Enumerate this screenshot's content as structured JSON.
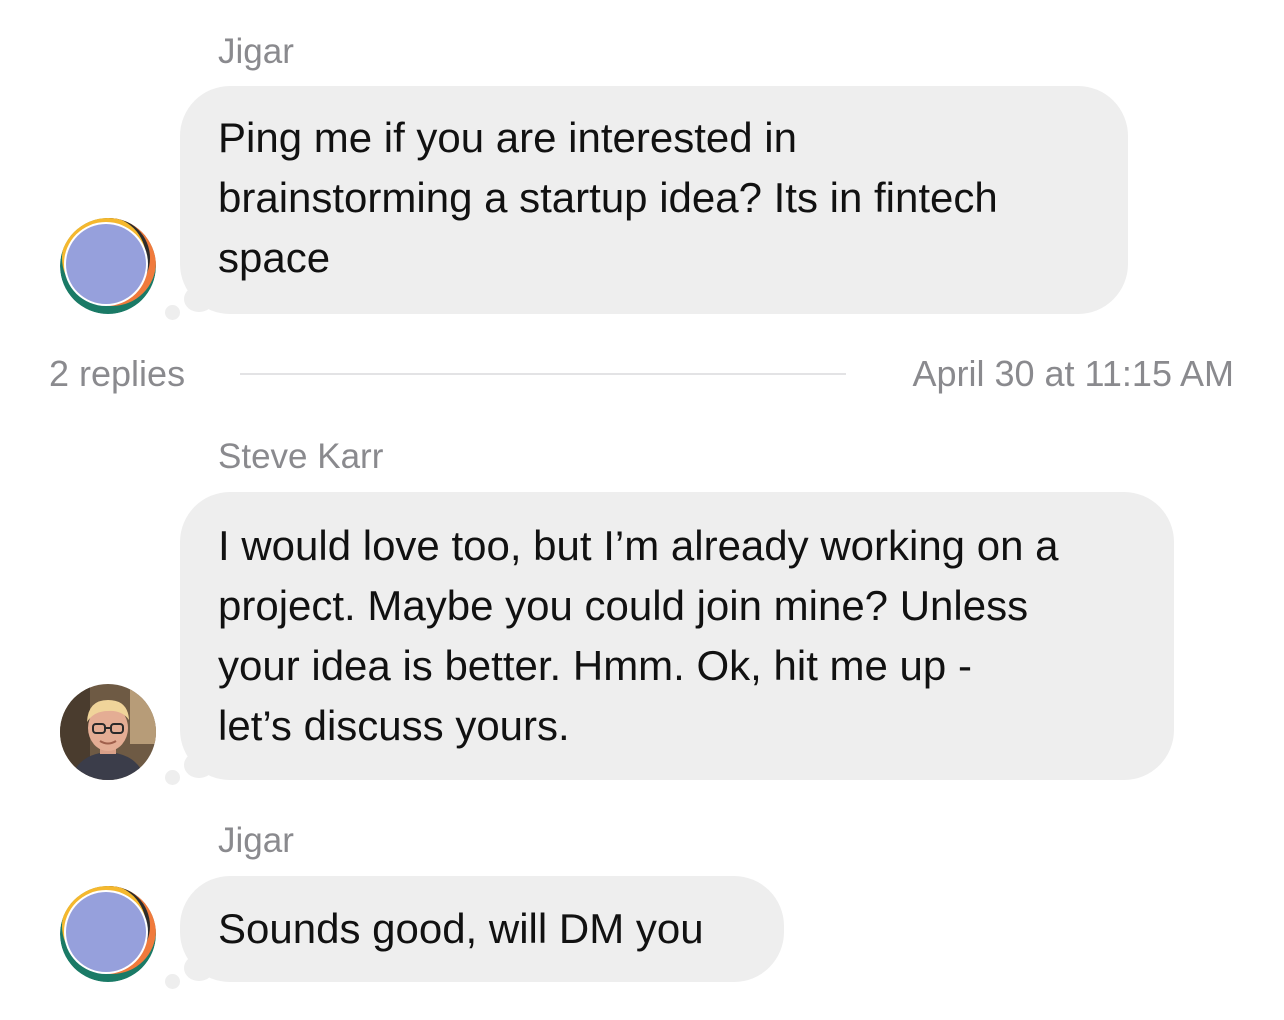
{
  "messages": [
    {
      "sender": "Jigar",
      "text": "Ping me if you are interested in\nbrainstorming a startup idea? Its in fintech\nspace",
      "avatar_icon": "abstract-color-avatar"
    },
    {
      "sender": "Steve Karr",
      "text": "I would love too, but I’m already working on a\nproject. Maybe you could join mine? Unless\nyour idea is better. Hmm. Ok, hit me up -\nlet’s discuss yours.",
      "avatar_icon": "profile-photo-avatar"
    },
    {
      "sender": "Jigar",
      "text": "Sounds good, will DM you",
      "avatar_icon": "abstract-color-avatar"
    }
  ],
  "thread": {
    "replies_label": "2 replies",
    "timestamp": "April 30 at 11:15 AM"
  },
  "colors": {
    "bubble_bg": "#eeeeee",
    "meta_text": "#8a8a8e",
    "avatar_purple": "#96a0dc",
    "avatar_orange": "#f07a3c",
    "avatar_yellow": "#f5b82e",
    "avatar_teal": "#1a7a66"
  }
}
